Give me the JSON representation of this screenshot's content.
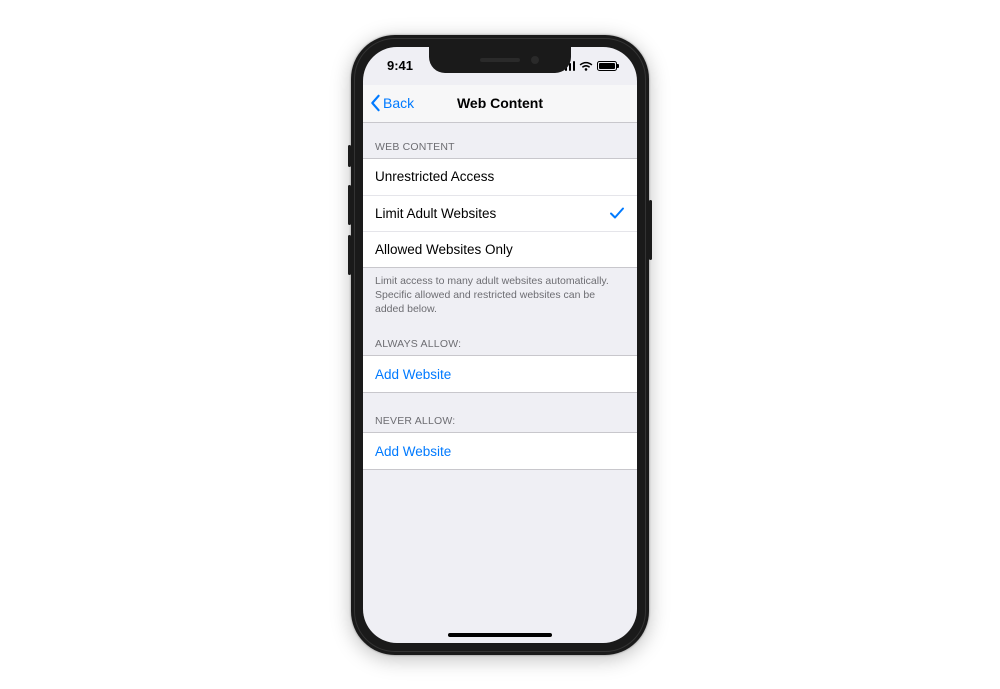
{
  "status": {
    "time": "9:41"
  },
  "nav": {
    "back": "Back",
    "title": "Web Content"
  },
  "sections": {
    "web_content": {
      "header": "WEB CONTENT",
      "options": [
        {
          "label": "Unrestricted Access",
          "selected": false
        },
        {
          "label": "Limit Adult Websites",
          "selected": true
        },
        {
          "label": "Allowed Websites Only",
          "selected": false
        }
      ],
      "footer": "Limit access to many adult websites automatically. Specific allowed and restricted websites can be added below."
    },
    "always_allow": {
      "header": "ALWAYS ALLOW:",
      "add_label": "Add Website"
    },
    "never_allow": {
      "header": "NEVER ALLOW:",
      "add_label": "Add Website"
    }
  }
}
